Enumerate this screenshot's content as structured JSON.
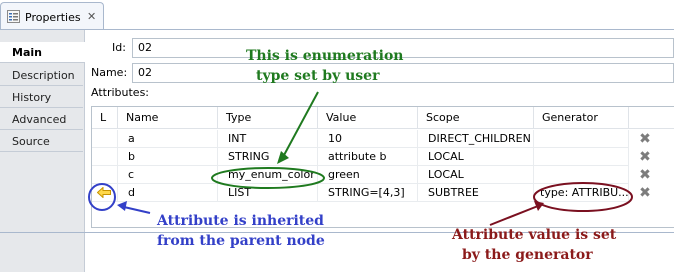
{
  "view": {
    "title": "Properties",
    "close_glyph": "✕"
  },
  "tabs": [
    "Main",
    "Description",
    "History",
    "Advanced",
    "Source"
  ],
  "fields": {
    "id_label": "Id:",
    "id_value": "02",
    "name_label": "Name:",
    "name_value": "02",
    "attributes_label": "Attributes:"
  },
  "table": {
    "headers": [
      "L",
      "Name",
      "Type",
      "Value",
      "Scope",
      "Generator"
    ],
    "rows": [
      {
        "l": "",
        "name": "a",
        "type": "INT",
        "value": "10",
        "scope": "DIRECT_CHILDREN",
        "generator": ""
      },
      {
        "l": "",
        "name": "b",
        "type": "STRING",
        "value": "attribute b",
        "scope": "LOCAL",
        "generator": ""
      },
      {
        "l": "",
        "name": "c",
        "type": "my_enum_color",
        "value": "green",
        "scope": "LOCAL",
        "generator": ""
      },
      {
        "l": "inherited-arrow-icon",
        "name": "d",
        "type": "LIST",
        "value": "STRING=[4,3]",
        "scope": "SUBTREE",
        "generator": "type: ATTRIBU..."
      }
    ],
    "delete_glyph": "✖"
  },
  "annotations": {
    "enum_line1": "This is enumeration",
    "enum_line2": "type set by user",
    "inherit_line1": "Attribute is inherited",
    "inherit_line2": "from the parent node",
    "gen_line1": "Attribute value is set",
    "gen_line2": "by the generator"
  },
  "colors": {
    "enum_annotation": "#1f7a1f",
    "inherit_annotation": "#3340c8",
    "generator_annotation": "#8b1a1a",
    "arrow_icon": "#e0b000"
  }
}
